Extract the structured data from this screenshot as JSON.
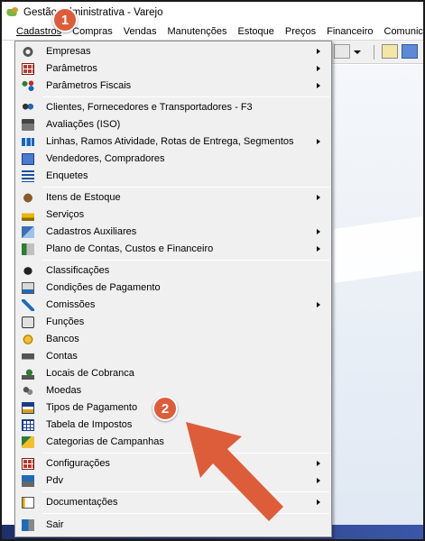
{
  "window": {
    "title": "Gestão Administrativa - Varejo"
  },
  "menubar": {
    "items": [
      "Cadastros",
      "Compras",
      "Vendas",
      "Manutenções",
      "Estoque",
      "Preços",
      "Financeiro",
      "Comunica"
    ]
  },
  "menu": {
    "items": [
      {
        "label": "Empresas",
        "icon": "gear-icon",
        "submenu": true
      },
      {
        "label": "Parâmetros",
        "icon": "grid-icon",
        "submenu": true
      },
      {
        "label": "Parâmetros Fiscais",
        "icon": "network-icon",
        "submenu": true
      },
      {
        "label": "Clientes, Fornecedores e Transportadores - F3",
        "icon": "people-icon",
        "submenu": false
      },
      {
        "label": "Avaliações (ISO)",
        "icon": "iso-icon",
        "submenu": false
      },
      {
        "label": "Linhas, Ramos Atividade, Rotas de Entrega, Segmentos",
        "icon": "bars-icon",
        "submenu": true
      },
      {
        "label": "Vendedores, Compradores",
        "icon": "sellers-icon",
        "submenu": false
      },
      {
        "label": "Enquetes",
        "icon": "list-icon",
        "submenu": false
      },
      {
        "label": "Itens de Estoque",
        "icon": "ball-icon",
        "submenu": true
      },
      {
        "label": "Serviços",
        "icon": "hardhat-icon",
        "submenu": false
      },
      {
        "label": "Cadastros Auxiliares",
        "icon": "folders-icon",
        "submenu": true
      },
      {
        "label": "Plano de Contas, Custos e Financeiro",
        "icon": "accounts-icon",
        "submenu": true
      },
      {
        "label": "Classificações",
        "icon": "classification-icon",
        "submenu": false
      },
      {
        "label": "Condições de Pagamento",
        "icon": "conditions-icon",
        "submenu": false
      },
      {
        "label": "Comissões",
        "icon": "commission-icon",
        "submenu": true
      },
      {
        "label": "Funções",
        "icon": "functions-icon",
        "submenu": false
      },
      {
        "label": "Bancos",
        "icon": "bank-icon",
        "submenu": false
      },
      {
        "label": "Contas",
        "icon": "account-icon",
        "submenu": false
      },
      {
        "label": "Locais de Cobranca",
        "icon": "location-icon",
        "submenu": false
      },
      {
        "label": "Moedas",
        "icon": "coins-icon",
        "submenu": false
      },
      {
        "label": "Tipos de Pagamento",
        "icon": "card-icon",
        "submenu": false
      },
      {
        "label": "Tabela de Impostos",
        "icon": "table-icon",
        "submenu": false
      },
      {
        "label": "Categorias de Campanhas",
        "icon": "campaign-icon",
        "submenu": false
      },
      {
        "label": "Configurações",
        "icon": "config-icon",
        "submenu": true
      },
      {
        "label": "Pdv",
        "icon": "pdv-icon",
        "submenu": true
      },
      {
        "label": "Documentações",
        "icon": "docs-icon",
        "submenu": true
      },
      {
        "label": "Sair",
        "icon": "exit-icon",
        "submenu": false
      }
    ]
  },
  "annotations": {
    "step1": "1",
    "step2": "2"
  },
  "colors": {
    "annotation": "#dd5d3a",
    "menu_bg": "#f0f0f0"
  }
}
